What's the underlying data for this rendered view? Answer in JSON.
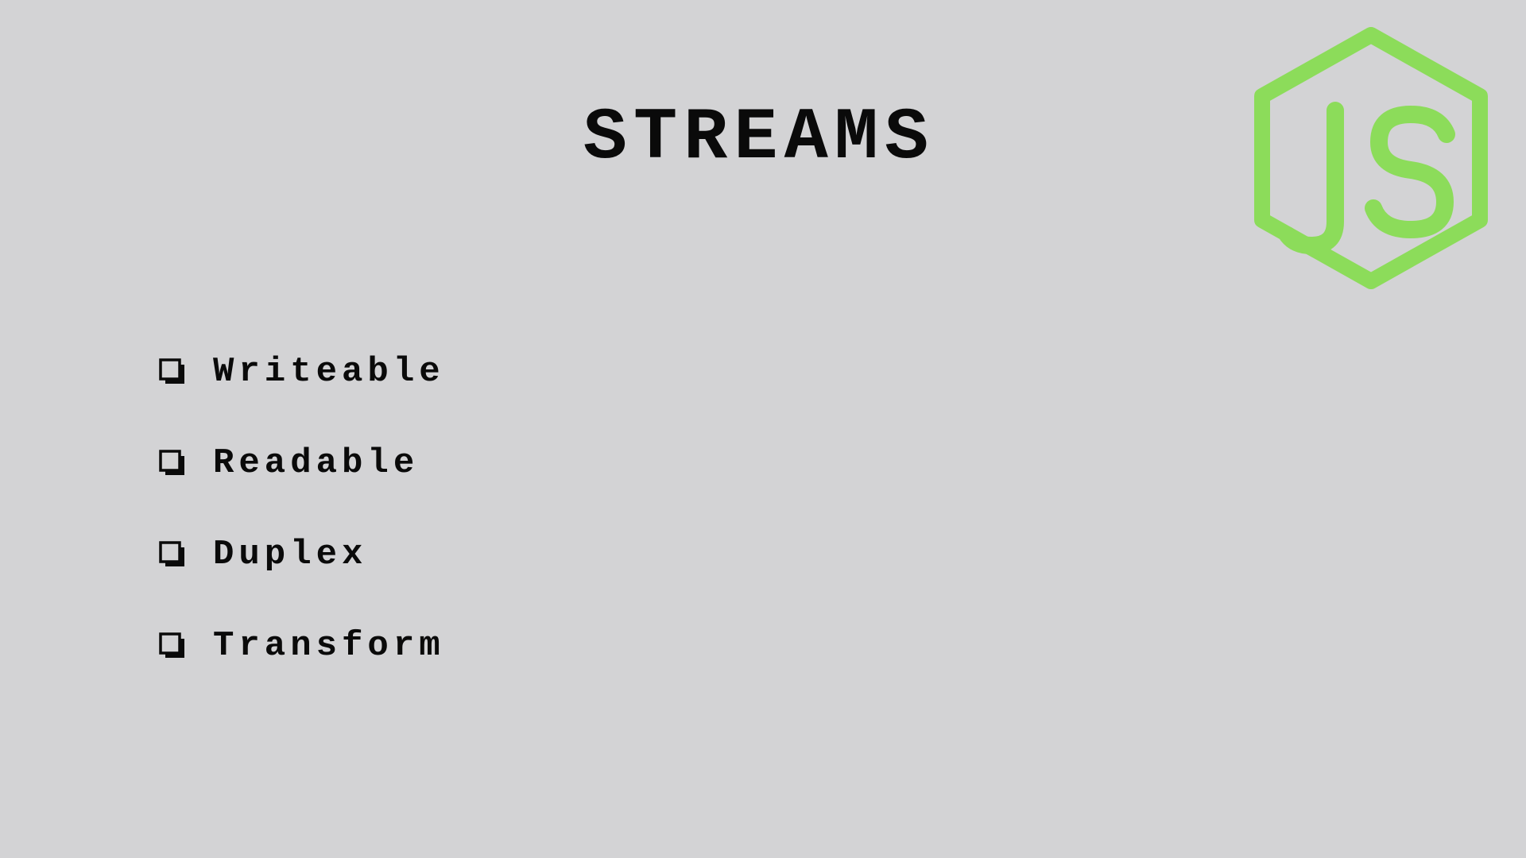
{
  "slide": {
    "title": "STREAMS",
    "logo": {
      "icon": "nodejs-hexagon-logo",
      "text": "JS",
      "color": "#8cdc5a"
    },
    "bullets": [
      {
        "label": "Writeable",
        "icon": "checkbox-icon"
      },
      {
        "label": "Readable",
        "icon": "checkbox-icon"
      },
      {
        "label": "Duplex",
        "icon": "checkbox-icon"
      },
      {
        "label": "Transform",
        "icon": "checkbox-icon"
      }
    ]
  },
  "colors": {
    "background": "#d3d3d5",
    "text": "#0a0a0a",
    "accent": "#8cdc5a"
  }
}
